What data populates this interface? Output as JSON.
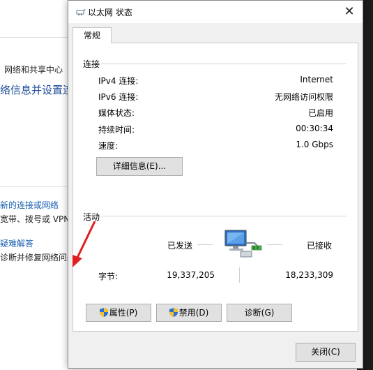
{
  "background": {
    "breadcrumb": "网络和共享中心",
    "heading": "络信息并设置连",
    "link1": "新的连接或网络",
    "desc1": "宽带、拨号或 VPN 连",
    "link2": "疑难解答",
    "desc2": "诊断并修复网络问题，或"
  },
  "dialog": {
    "title": "以太网 状态",
    "close_glyph": "✕",
    "tab_general": "常规",
    "connection": {
      "group_label": "连接",
      "rows": [
        {
          "label": "IPv4 连接:",
          "value": "Internet"
        },
        {
          "label": "IPv6 连接:",
          "value": "无网络访问权限"
        },
        {
          "label": "媒体状态:",
          "value": "已启用"
        },
        {
          "label": "持续时间:",
          "value": "00:30:34"
        },
        {
          "label": "速度:",
          "value": "1.0 Gbps"
        }
      ],
      "details_button": "详细信息(E)..."
    },
    "activity": {
      "group_label": "活动",
      "sent_label": "已发送",
      "received_label": "已接收",
      "bytes_label": "字节:",
      "bytes_sent": "19,337,205",
      "bytes_received": "18,233,309"
    },
    "buttons": {
      "properties": "属性(P)",
      "disable": "禁用(D)",
      "diagnose": "诊断(G)",
      "close": "关闭(C)"
    }
  },
  "colors": {
    "link": "#1a5fb4",
    "annotation_arrow": "#e02020",
    "button_face": "#e1e1e1"
  },
  "icons": [
    "network-adapter-icon",
    "uac-shield-icon",
    "close-icon",
    "computer-network-icon"
  ]
}
